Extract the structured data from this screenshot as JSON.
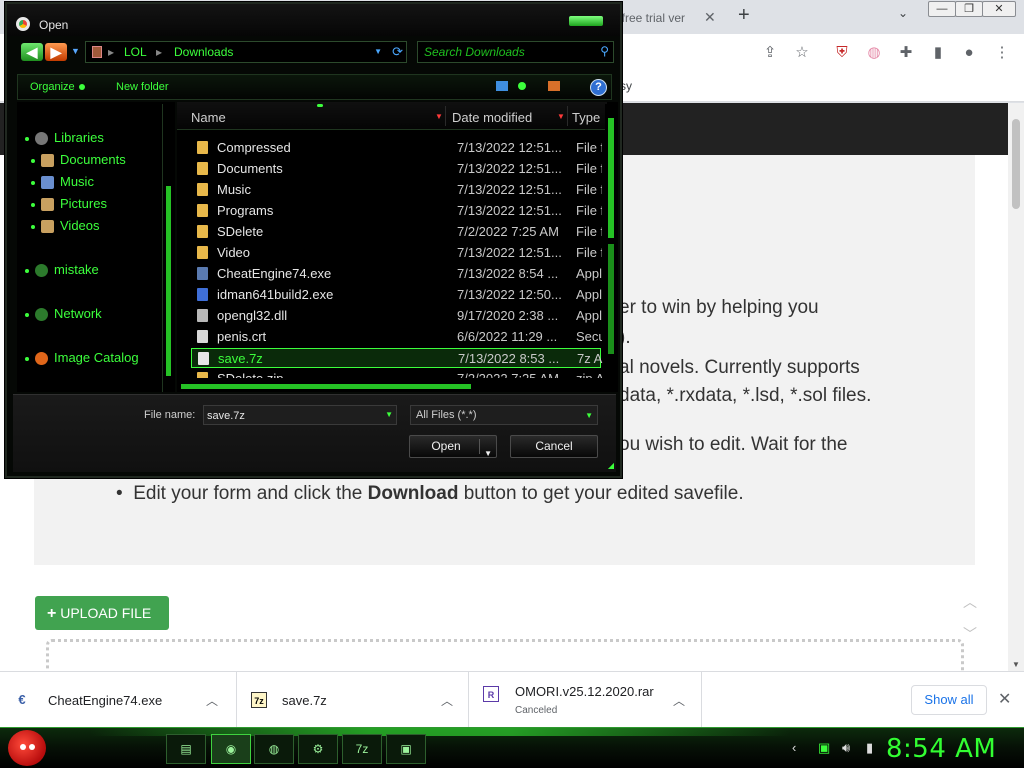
{
  "browser": {
    "tab_partial_label": "t free trial ver",
    "bookmark_partial": "sy"
  },
  "page": {
    "text_lines": [
      "er to win by helping you",
      ").",
      "al novels. Currently supports",
      "data, *.rxdata, *.lsd, *.sol files.",
      "ou wish to edit. Wait for the"
    ],
    "last_bullet_pre": "Edit your form and click the ",
    "last_bullet_bold": "Download",
    "last_bullet_post": " button to get your edited savefile.",
    "upload_button": "UPLOAD FILE"
  },
  "dialog": {
    "title": "Open",
    "address": [
      "LOL",
      "Downloads"
    ],
    "search_placeholder": "Search Downloads",
    "commands": {
      "organize": "Organize",
      "new_folder": "New folder"
    },
    "nav": [
      {
        "label": "Libraries",
        "icon": "libraries-icon",
        "color": "#777777"
      },
      {
        "label": "Documents",
        "icon": "documents-icon",
        "color": "#c8a060"
      },
      {
        "label": "Music",
        "icon": "music-icon",
        "color": "#6a8fd0"
      },
      {
        "label": "Pictures",
        "icon": "pictures-icon",
        "color": "#c8a060"
      },
      {
        "label": "Videos",
        "icon": "videos-icon",
        "color": "#c8a060"
      },
      {
        "label": "mistake",
        "icon": "homegroup-icon",
        "color": "#2c7a2c"
      },
      {
        "label": "Network",
        "icon": "network-icon",
        "color": "#2c7a2c"
      },
      {
        "label": "Image Catalog",
        "icon": "image-catalog-icon",
        "color": "#e0661a"
      }
    ],
    "columns": {
      "name": "Name",
      "date": "Date modified",
      "type": "Type"
    },
    "files": [
      {
        "name": "Compressed",
        "date": "7/13/2022 12:51...",
        "type": "File f",
        "icon": "folder-icon",
        "color": "#e8b84a"
      },
      {
        "name": "Documents",
        "date": "7/13/2022 12:51...",
        "type": "File f",
        "icon": "folder-icon",
        "color": "#e8b84a"
      },
      {
        "name": "Music",
        "date": "7/13/2022 12:51...",
        "type": "File f",
        "icon": "folder-icon",
        "color": "#e8b84a"
      },
      {
        "name": "Programs",
        "date": "7/13/2022 12:51...",
        "type": "File f",
        "icon": "folder-icon",
        "color": "#e8b84a"
      },
      {
        "name": "SDelete",
        "date": "7/2/2022 7:25 AM",
        "type": "File f",
        "icon": "folder-icon",
        "color": "#e8b84a"
      },
      {
        "name": "Video",
        "date": "7/13/2022 12:51...",
        "type": "File f",
        "icon": "folder-icon",
        "color": "#e8b84a"
      },
      {
        "name": "CheatEngine74.exe",
        "date": "7/13/2022 8:54 ...",
        "type": "Appli",
        "icon": "cheatengine-icon",
        "color": "#5a7ab0"
      },
      {
        "name": "idman641build2.exe",
        "date": "7/13/2022 12:50...",
        "type": "Appli",
        "icon": "idm-icon",
        "color": "#3f6fd8"
      },
      {
        "name": "opengl32.dll",
        "date": "9/17/2020 2:38 ...",
        "type": "Appli",
        "icon": "dll-icon",
        "color": "#b9b9b9"
      },
      {
        "name": "penis.crt",
        "date": "6/6/2022 11:29 ...",
        "type": "Secu",
        "icon": "certificate-icon",
        "color": "#d8d8d8"
      },
      {
        "name": "save.7z",
        "date": "7/13/2022 8:53 ...",
        "type": "7z A",
        "icon": "7z-icon",
        "color": "#e6e6e6"
      },
      {
        "name": "SDelete.zip",
        "date": "7/2/2022 7:25 AM",
        "type": "zip A",
        "icon": "zip-icon",
        "color": "#e8b84a"
      }
    ],
    "selected_index": 10,
    "file_name_label": "File name:",
    "file_name_value": "save.7z",
    "filter": "All Files (*.*)",
    "open_button": "Open",
    "cancel_button": "Cancel"
  },
  "downloads": [
    {
      "name": "CheatEngine74.exe",
      "status": "",
      "icon": "cheatengine-icon"
    },
    {
      "name": "save.7z",
      "status": "",
      "icon": "7z-icon"
    },
    {
      "name": "OMORI.v25.12.2020.rar",
      "status": "Canceled",
      "icon": "rar-icon"
    }
  ],
  "downloads_show_all": "Show all",
  "taskbar": {
    "clock": "8:54 AM",
    "apps": [
      "file-explorer-icon",
      "chrome-icon",
      "globe-icon",
      "cheatengine-icon",
      "7z-icon",
      "window-icon"
    ]
  }
}
